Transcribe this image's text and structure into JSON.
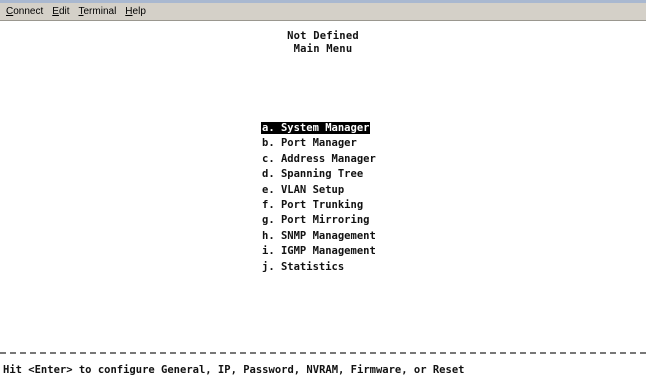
{
  "menubar": {
    "items": [
      {
        "first": "C",
        "rest": "onnect"
      },
      {
        "first": "E",
        "rest": "dit"
      },
      {
        "first": "T",
        "rest": "erminal"
      },
      {
        "first": "H",
        "rest": "elp"
      }
    ]
  },
  "terminal": {
    "header_title": "Not Defined",
    "header_subtitle": "Main Menu",
    "menu": [
      {
        "label": "a. System Manager",
        "selected": true
      },
      {
        "label": "b. Port Manager",
        "selected": false
      },
      {
        "label": "c. Address Manager",
        "selected": false
      },
      {
        "label": "d. Spanning Tree",
        "selected": false
      },
      {
        "label": "e. VLAN Setup",
        "selected": false
      },
      {
        "label": "f. Port Trunking",
        "selected": false
      },
      {
        "label": "g. Port Mirroring",
        "selected": false
      },
      {
        "label": "h. SNMP Management",
        "selected": false
      },
      {
        "label": "i. IGMP Management",
        "selected": false
      },
      {
        "label": "j. Statistics",
        "selected": false
      }
    ],
    "status_line": "Hit <Enter> to configure General, IP, Password, NVRAM, Firmware, or Reset"
  }
}
